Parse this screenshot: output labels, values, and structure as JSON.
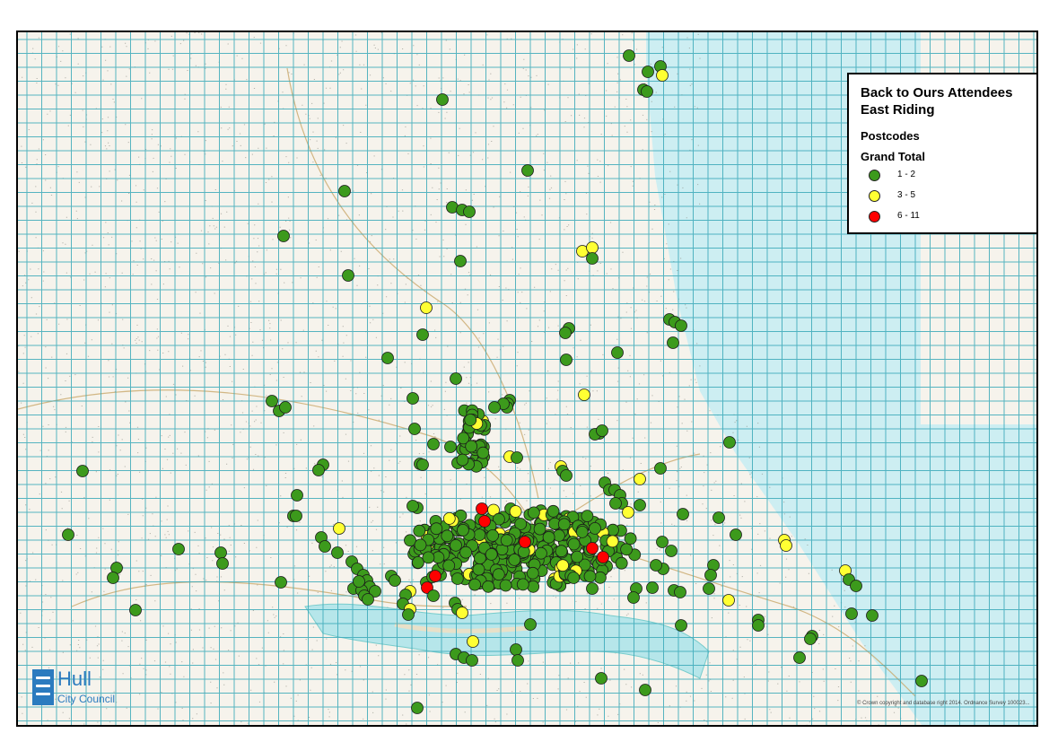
{
  "legend": {
    "title_line1": "Back to Ours Attendees",
    "title_line2": "East Riding",
    "subtitle": "Postcodes",
    "field": "Grand Total",
    "classes": [
      {
        "label": "1 - 2",
        "color": "#3c9a1c"
      },
      {
        "label": "3 - 5",
        "color": "#ffff33"
      },
      {
        "label": "6 - 11",
        "color": "#ff0000"
      }
    ]
  },
  "logo": {
    "name": "Hull",
    "subtitle": "City Council"
  },
  "copyright": "© Crown copyright and database right 2014. Ordnance Survey 100023..."
}
